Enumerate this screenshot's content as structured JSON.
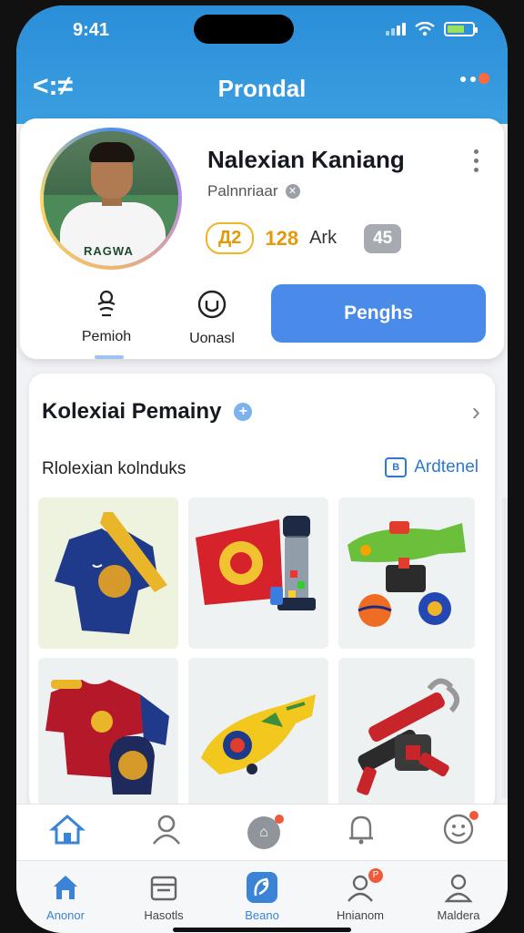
{
  "status_bar": {
    "time": "9:41",
    "battery_level": 0.7
  },
  "header": {
    "back_label": "<:≠",
    "title": "Prondal"
  },
  "profile": {
    "name": "Nalexian Kaniang",
    "role": "Palnnriaar",
    "shirt_text": "RAGWA",
    "stats": {
      "badge": "Д2",
      "score": "128",
      "unit": "Ark",
      "rank": "45"
    },
    "actions": [
      {
        "label": "Pemioh",
        "icon": "person-scribble-icon"
      },
      {
        "label": "Uonasl",
        "icon": "shield-badge-icon"
      }
    ],
    "follow_label": "Penghs"
  },
  "collection": {
    "title": "Kolexiai Pemainy",
    "subtitle": "Rlolexian kolnduks",
    "link_label": "Ardtenel",
    "items": [
      "jersey-navy-gold",
      "pennant-and-candy-jar",
      "toy-blaster-and-balls",
      "jersey-red-navy-with-bag",
      "yellow-toy-rocket",
      "toy-robot-claw"
    ]
  },
  "tabbar_top": [
    {
      "icon": "home-icon"
    },
    {
      "icon": "person-icon"
    },
    {
      "icon": "message-icon",
      "glyph": "⌂"
    },
    {
      "icon": "bell-icon"
    },
    {
      "icon": "smiley-icon"
    }
  ],
  "tabbar_bottom": [
    {
      "label": "Anonor",
      "icon": "home-icon",
      "active": true
    },
    {
      "label": "Hasotls",
      "icon": "store-icon"
    },
    {
      "label": "Beano",
      "icon": "tag-icon",
      "active": true
    },
    {
      "label": "Hnianom",
      "icon": "profile-icon",
      "badge": "P"
    },
    {
      "label": "Maldera",
      "icon": "user-icon"
    }
  ],
  "colors": {
    "primary": "#2a8ed9",
    "button": "#4a8ae8",
    "accent": "#e29a08"
  }
}
